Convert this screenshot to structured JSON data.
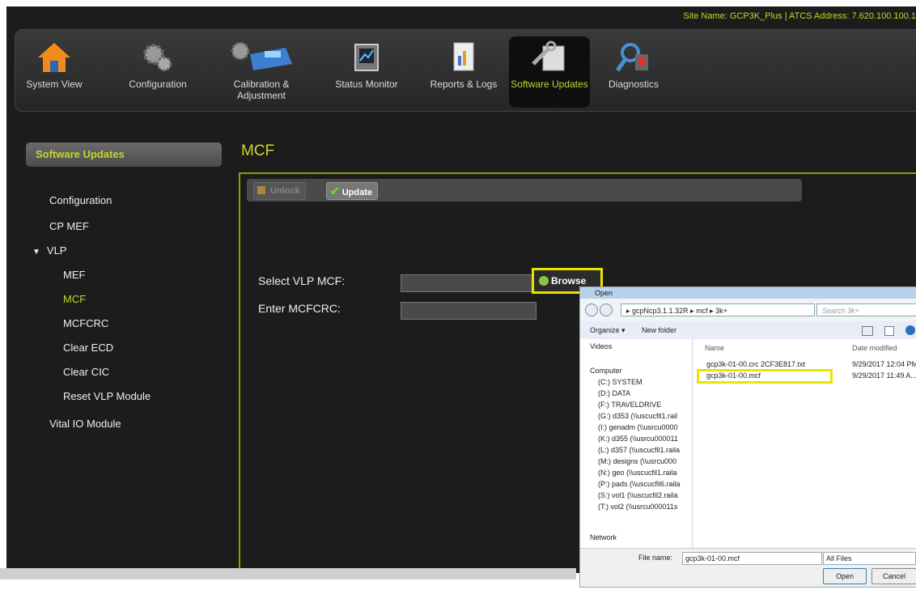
{
  "site_info": "Site Name: GCP3K_Plus | ATCS Address: 7.620.100.100.1",
  "nav": [
    {
      "label": "System View",
      "icon": "house-icon"
    },
    {
      "label": "Configuration",
      "icon": "gears-icon"
    },
    {
      "label": "Calibration & Adjustment",
      "icon": "train-icon"
    },
    {
      "label": "Status Monitor",
      "icon": "monitor-icon"
    },
    {
      "label": "Reports & Logs",
      "icon": "report-icon"
    },
    {
      "label": "Software Updates",
      "icon": "software-update-icon",
      "active": true
    },
    {
      "label": "Diagnostics",
      "icon": "diagnostics-icon"
    }
  ],
  "sidebar": {
    "header": "Software Updates",
    "items": [
      "Configuration",
      "CP MEF",
      "VLP",
      "MEF",
      "MCF",
      "MCFCRC",
      "Clear ECD",
      "Clear CIC",
      "Reset VLP Module",
      "Vital IO Module"
    ],
    "selected": "MCF"
  },
  "page_title": "MCF",
  "toolbar": {
    "unlock": "Unlock",
    "update": "Update"
  },
  "form": {
    "select_label": "Select VLP MCF:",
    "crc_label": "Enter MCFCRC:",
    "browse": "Browse"
  },
  "dialog": {
    "title": "Open",
    "breadcrumb": "▸ gcpNcp3.1.1.32R ▸ mcf ▸ 3k+",
    "search_placeholder": "Search 3k+",
    "organize": "Organize ▾",
    "new_folder": "New folder",
    "tree": [
      "Videos",
      "Computer",
      "(C:) SYSTEM",
      "(D:) DATA",
      "(F:) TRAVELDRIVE",
      "(G:) d353 (\\\\uscucfil1.rail",
      "(I:) genadm (\\\\usrcu0000",
      "(K:) d355 (\\\\usrcu000011",
      "(L:) d357 (\\\\uscucfil1.raila",
      "(M:) designs (\\\\usrcu000",
      "(N:) geo (\\\\uscucfil1.raila",
      "(P:) pads (\\\\uscucfil6.raila",
      "(S:) vol1 (\\\\uscucfil2.raila",
      "(T:) vol2 (\\\\usrcu000011s",
      "Network"
    ],
    "col_name": "Name",
    "col_date": "Date modified",
    "files": [
      {
        "name": "gcp3k-01-00.crc 2CF3E817.txt",
        "date": "9/29/2017 12:04 PM"
      },
      {
        "name": "gcp3k-01-00.mcf",
        "date": "9/29/2017 11:49 A..."
      }
    ],
    "file_name_label": "File name:",
    "file_name_value": "gcp3k-01-00.mcf",
    "filter": "All Files",
    "open": "Open",
    "cancel": "Cancel"
  }
}
